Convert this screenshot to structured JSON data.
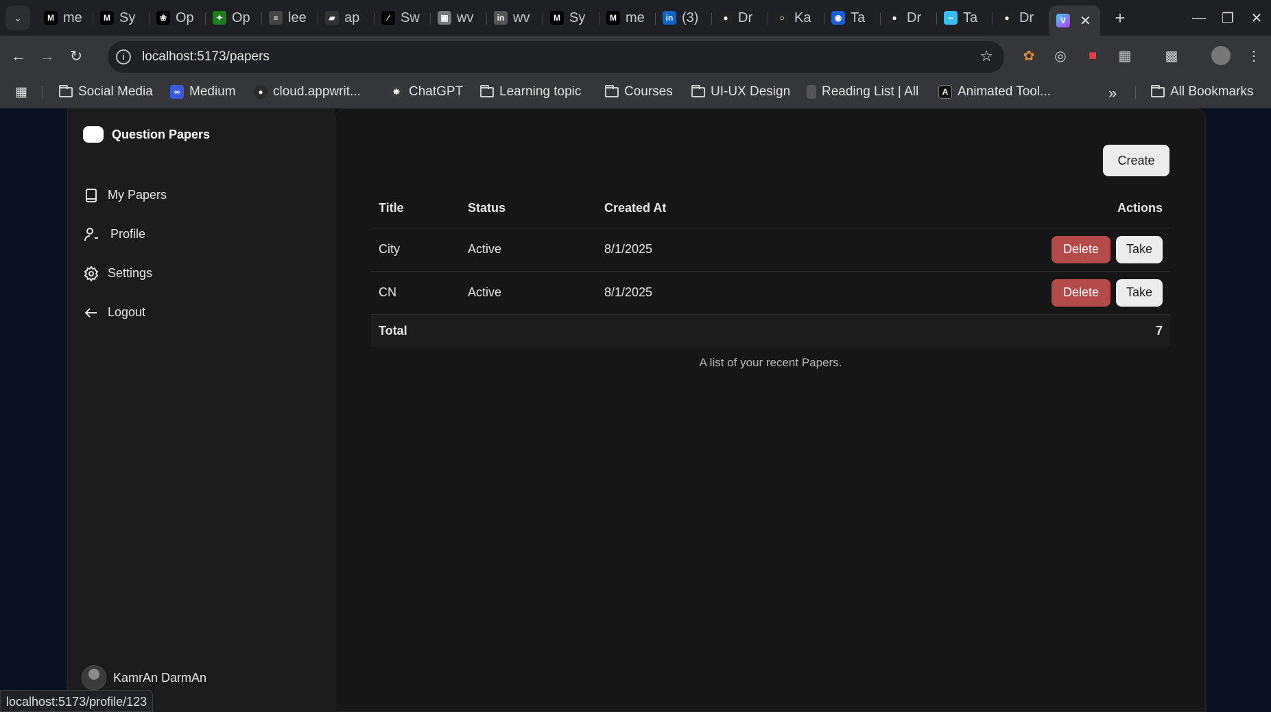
{
  "browser": {
    "tabs": [
      {
        "label": "me",
        "icon": "medium-icon",
        "color": "#000000"
      },
      {
        "label": "Sy",
        "icon": "medium-icon",
        "color": "#000000"
      },
      {
        "label": "Op",
        "icon": "openai-icon",
        "color": "#000000"
      },
      {
        "label": "Op",
        "icon": "sparkle-icon",
        "color": "#1a7f1a"
      },
      {
        "label": "lee",
        "icon": "leetcode-icon",
        "color": "#444444"
      },
      {
        "label": "ap",
        "icon": "appwrite-icon",
        "color": "#333333"
      },
      {
        "label": "Sw",
        "icon": "pen-icon",
        "color": "#000000"
      },
      {
        "label": "wv",
        "icon": "image-icon",
        "color": "#777777"
      },
      {
        "label": "wv",
        "icon": "linkedin-icon",
        "color": "#555555"
      },
      {
        "label": "Sy",
        "icon": "medium-icon",
        "color": "#000000"
      },
      {
        "label": "me",
        "icon": "medium-icon",
        "color": "#000000"
      },
      {
        "label": "(3)",
        "icon": "linkedin-icon",
        "color": "#0a66c2"
      },
      {
        "label": "Dr",
        "icon": "drizzle-icon",
        "color": "#222222"
      },
      {
        "label": "Ka",
        "icon": "github-icon",
        "color": "#222222"
      },
      {
        "label": "Ta",
        "icon": "globe-icon",
        "color": "#1a5fd6"
      },
      {
        "label": "Dr",
        "icon": "drizzle-icon",
        "color": "#222222"
      },
      {
        "label": "Ta",
        "icon": "tailwind-icon",
        "color": "#38bdf8"
      },
      {
        "label": "Dr",
        "icon": "drizzle-icon",
        "color": "#222222"
      }
    ],
    "active_tab": {
      "icon": "vite-icon"
    },
    "url": "localhost:5173/papers",
    "bookmarks": [
      {
        "label": "Social Media",
        "icon": "folder-icon"
      },
      {
        "label": "Medium",
        "icon": "medium-icon"
      },
      {
        "label": "cloud.appwrit...",
        "icon": "github-icon"
      },
      {
        "label": "ChatGPT",
        "icon": "openai-icon"
      },
      {
        "label": "Learning topic",
        "icon": "folder-icon"
      },
      {
        "label": "Courses",
        "icon": "folder-icon"
      },
      {
        "label": "UI-UX Design",
        "icon": "folder-icon"
      },
      {
        "label": "Reading List | All",
        "icon": "book-icon"
      },
      {
        "label": "Animated Tool...",
        "icon": "a-icon"
      }
    ],
    "all_bookmarks": "All Bookmarks",
    "status_url": "localhost:5173/profile/123"
  },
  "app": {
    "brand": "Question Papers",
    "nav": [
      {
        "label": "My Papers",
        "icon": "book-icon"
      },
      {
        "label": "Profile",
        "icon": "user-icon"
      },
      {
        "label": "Settings",
        "icon": "gear-icon"
      },
      {
        "label": "Logout",
        "icon": "arrow-left-icon"
      }
    ],
    "user": {
      "name": "KamrAn DarmAn"
    },
    "create_label": "Create",
    "table": {
      "headers": {
        "title": "Title",
        "status": "Status",
        "created": "Created At",
        "actions": "Actions"
      },
      "rows": [
        {
          "title": "City",
          "status": "Active",
          "created": "8/1/2025",
          "delete": "Delete",
          "take": "Take"
        },
        {
          "title": "CN",
          "status": "Active",
          "created": "8/1/2025",
          "delete": "Delete",
          "take": "Take"
        }
      ],
      "footer": {
        "label": "Total",
        "value": "7"
      },
      "caption": "A list of your recent Papers."
    },
    "colors": {
      "delete": "#b54a4a",
      "background": "#161616",
      "sidebar": "#1c1c1c"
    }
  }
}
